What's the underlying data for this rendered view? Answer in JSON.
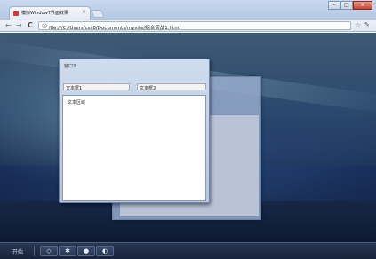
{
  "browser": {
    "tab_title": "模拟Window7界面效果",
    "tab_close": "×",
    "window_buttons": {
      "minimize": "–",
      "maximize": "□",
      "close": "✕"
    },
    "nav": {
      "back": "←",
      "forward": "→",
      "reload": "C"
    },
    "address_icon": "page-icon",
    "address": "file:///C:/Users/css8/Documents/mysite/综合实战1.html",
    "star": "☆",
    "wrench": "🔧"
  },
  "windows": {
    "front": {
      "title": "窗口3",
      "field1": "文本框1",
      "field2": "文本框2",
      "textarea": "文本区域"
    }
  },
  "taskbar": {
    "start_label": "开始",
    "buttons": [
      "◇",
      "✱",
      "●",
      "◐"
    ]
  }
}
